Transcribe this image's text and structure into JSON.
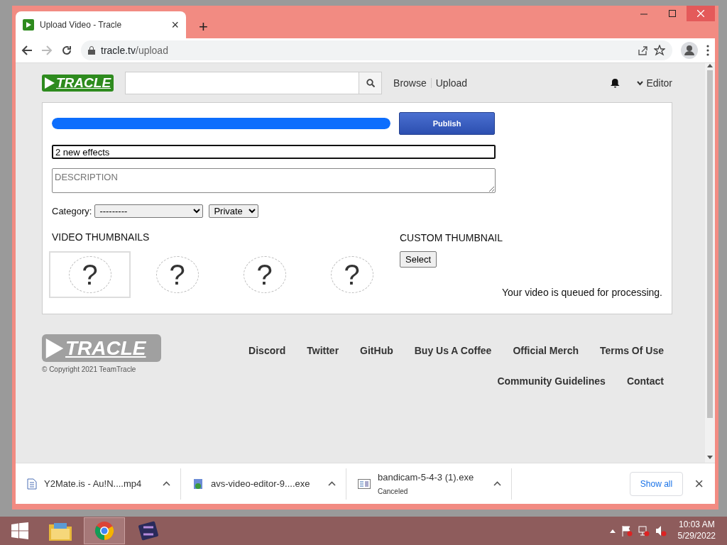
{
  "browser": {
    "tab": {
      "title": "Upload Video - Tracle",
      "close": "×"
    },
    "new_tab": "+",
    "address": {
      "domain": "tracle.tv",
      "path": "/upload"
    }
  },
  "header": {
    "logo": "TRACLE",
    "nav_links": [
      "Browse",
      "Upload"
    ],
    "user": {
      "name": "Editor"
    }
  },
  "upload": {
    "progress": {
      "level": 1.0
    },
    "publish_button": "Publish",
    "title_field": {
      "value": "2 new effects"
    },
    "description": {
      "placeholder": "DESCRIPTION"
    },
    "category": {
      "label": "Category:",
      "value": "---------"
    },
    "privacy": {
      "value": "Private"
    },
    "video_thumbnails": {
      "heading": "VIDEO THUMBNAILS",
      "items": [
        {
          "label": "?",
          "selected": true
        },
        {
          "label": "?",
          "selected": false
        },
        {
          "label": "?",
          "selected": false
        },
        {
          "label": "?",
          "selected": false
        }
      ]
    },
    "custom_thumbnail": {
      "heading": "CUSTOM THUMBNAIL",
      "button": "Select"
    },
    "status": "Your video is queued for processing."
  },
  "footer": {
    "logo": "TRACLE",
    "copyright": "© Copyright 2021 TeamTracle",
    "link_rows": [
      [
        "Discord",
        "Twitter",
        "GitHub",
        "Buy Us A Coffee",
        "Official Merch",
        "Terms Of Use"
      ],
      [
        "Community Guidelines",
        "Contact"
      ]
    ]
  },
  "downloads": {
    "items": [
      {
        "name": "Y2Mate.is - Au!N....mp4"
      },
      {
        "name": "avs-video-editor-9....exe"
      },
      {
        "name": "bandicam-5-4-3 (1).exe",
        "status": "Canceled"
      }
    ],
    "show_all": "Show all",
    "close": "×"
  },
  "taskbar": {
    "apps": [
      {
        "kind": "folder",
        "selected": false
      },
      {
        "kind": "browser",
        "selected": true
      },
      {
        "kind": "film",
        "selected": false
      }
    ],
    "clock": {
      "time": "10:03 AM",
      "date": "5/29/2022"
    }
  }
}
